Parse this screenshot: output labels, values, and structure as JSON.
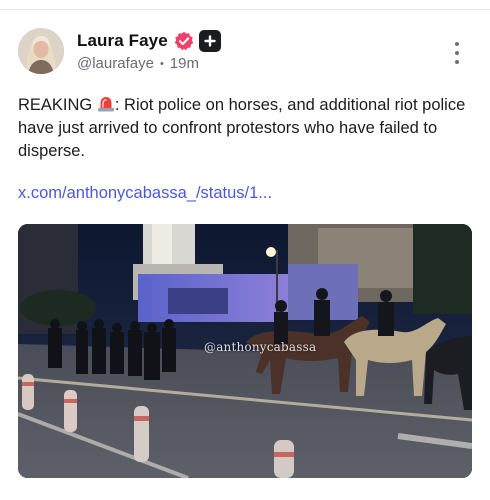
{
  "post": {
    "author": {
      "display_name": "Laura Faye",
      "handle": "@laurafaye",
      "verified": true,
      "plus_badge_symbol": "+"
    },
    "time_ago": "19m",
    "separator": "•",
    "text_prefix": "REAKING",
    "text_emoji": "police-light-emoji",
    "text_body": ": Riot police on horses, and additional riot police have just arrived to confront protestors who have failed to disperse.",
    "link": "x.com/anthonycabassa_/status/1...",
    "media": {
      "type": "video-still",
      "watermark": "@anthonycabassa"
    }
  },
  "icons": {
    "verified": "verified-rosette-icon",
    "plus": "plus-badge-icon",
    "more": "more-vertical-icon"
  },
  "colors": {
    "accent_link": "#4a5bd4",
    "verified_badge": "#f0416a",
    "plus_badge": "#1b1b22",
    "muted_text": "#6b6b75"
  }
}
